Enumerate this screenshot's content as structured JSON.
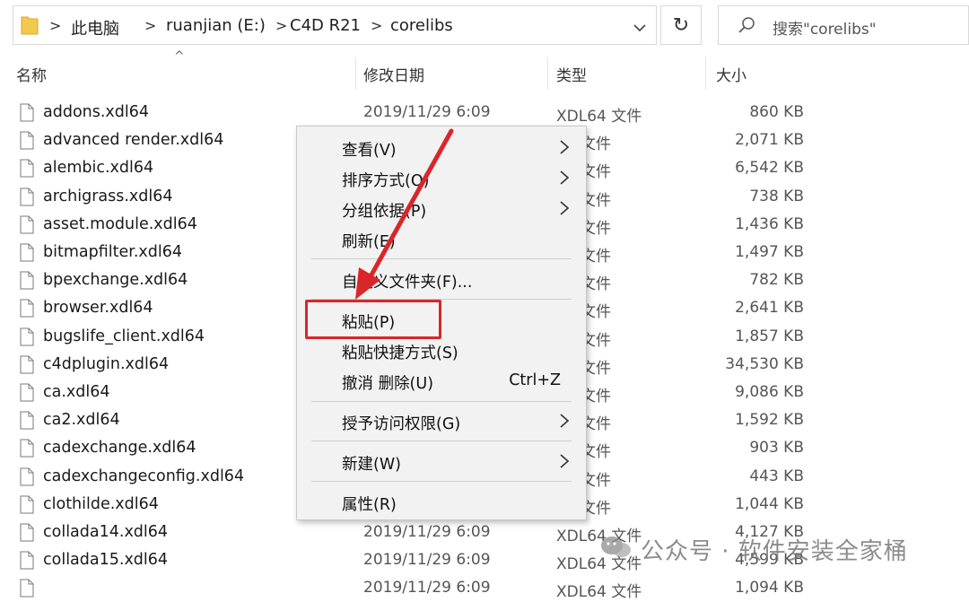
{
  "address_bar": {
    "crumbs": [
      "此电脑",
      "ruanjian (E:)",
      "C4D R21",
      "corelibs"
    ],
    "separator": ">",
    "dropdown_glyph": "⌄"
  },
  "refresh_icon": "↻",
  "search": {
    "placeholder": "搜索\"corelibs\""
  },
  "columns": {
    "name": "名称",
    "modified": "修改日期",
    "type": "类型",
    "size": "大小"
  },
  "sort_indicator": "^",
  "files": [
    {
      "name": "addons.xdl64",
      "date": "2019/11/29 6:09",
      "type": "XDL64 文件",
      "size": "860 KB"
    },
    {
      "name": "advanced render.xdl64",
      "date": "",
      "type": "64 文件",
      "size": "2,071 KB"
    },
    {
      "name": "alembic.xdl64",
      "date": "",
      "type": "64 文件",
      "size": "6,542 KB"
    },
    {
      "name": "archigrass.xdl64",
      "date": "",
      "type": "64 文件",
      "size": "738 KB"
    },
    {
      "name": "asset.module.xdl64",
      "date": "",
      "type": "64 文件",
      "size": "1,436 KB"
    },
    {
      "name": "bitmapfilter.xdl64",
      "date": "",
      "type": "64 文件",
      "size": "1,497 KB"
    },
    {
      "name": "bpexchange.xdl64",
      "date": "",
      "type": "64 文件",
      "size": "782 KB"
    },
    {
      "name": "browser.xdl64",
      "date": "",
      "type": "64 文件",
      "size": "2,641 KB"
    },
    {
      "name": "bugslife_client.xdl64",
      "date": "",
      "type": "64 文件",
      "size": "1,857 KB"
    },
    {
      "name": "c4dplugin.xdl64",
      "date": "",
      "type": "64 文件",
      "size": "34,530 KB"
    },
    {
      "name": "ca.xdl64",
      "date": "",
      "type": "64 文件",
      "size": "9,086 KB"
    },
    {
      "name": "ca2.xdl64",
      "date": "",
      "type": "64 文件",
      "size": "1,592 KB"
    },
    {
      "name": "cadexchange.xdl64",
      "date": "",
      "type": "64 文件",
      "size": "903 KB"
    },
    {
      "name": "cadexchangeconfig.xdl64",
      "date": "",
      "type": "64 文件",
      "size": "443 KB"
    },
    {
      "name": "clothilde.xdl64",
      "date": "",
      "type": "64 文件",
      "size": "1,044 KB"
    },
    {
      "name": "collada14.xdl64",
      "date": "2019/11/29 6:09",
      "type": "XDL64 文件",
      "size": "4,127 KB"
    },
    {
      "name": "collada15.xdl64",
      "date": "2019/11/29 6:09",
      "type": "XDL64 文件",
      "size": "4,599 KB"
    },
    {
      "name": "",
      "date": "2019/11/29 6:09",
      "type": "XDL64 文件",
      "size": "1,094 KB"
    }
  ],
  "context_menu": {
    "items": [
      {
        "label": "查看(V)",
        "submenu": true
      },
      {
        "label": "排序方式(O)",
        "submenu": true
      },
      {
        "label": "分组依据(P)",
        "submenu": true
      },
      {
        "label": "刷新(E)",
        "submenu": false
      },
      {
        "label": "自定义文件夹(F)...",
        "submenu": false
      },
      {
        "label": "粘贴(P)",
        "submenu": false
      },
      {
        "label": "粘贴快捷方式(S)",
        "submenu": false
      },
      {
        "label": "撤消 删除(U)",
        "submenu": false,
        "shortcut": "Ctrl+Z"
      },
      {
        "label": "授予访问权限(G)",
        "submenu": true
      },
      {
        "label": "新建(W)",
        "submenu": true
      },
      {
        "label": "属性(R)",
        "submenu": false
      }
    ]
  },
  "watermark": {
    "text": "公众号 · 软件安装全家桶"
  },
  "colors": {
    "highlight": "#d9262a",
    "menu_bg": "#f2f2f2",
    "folder": "#f3c94d"
  }
}
